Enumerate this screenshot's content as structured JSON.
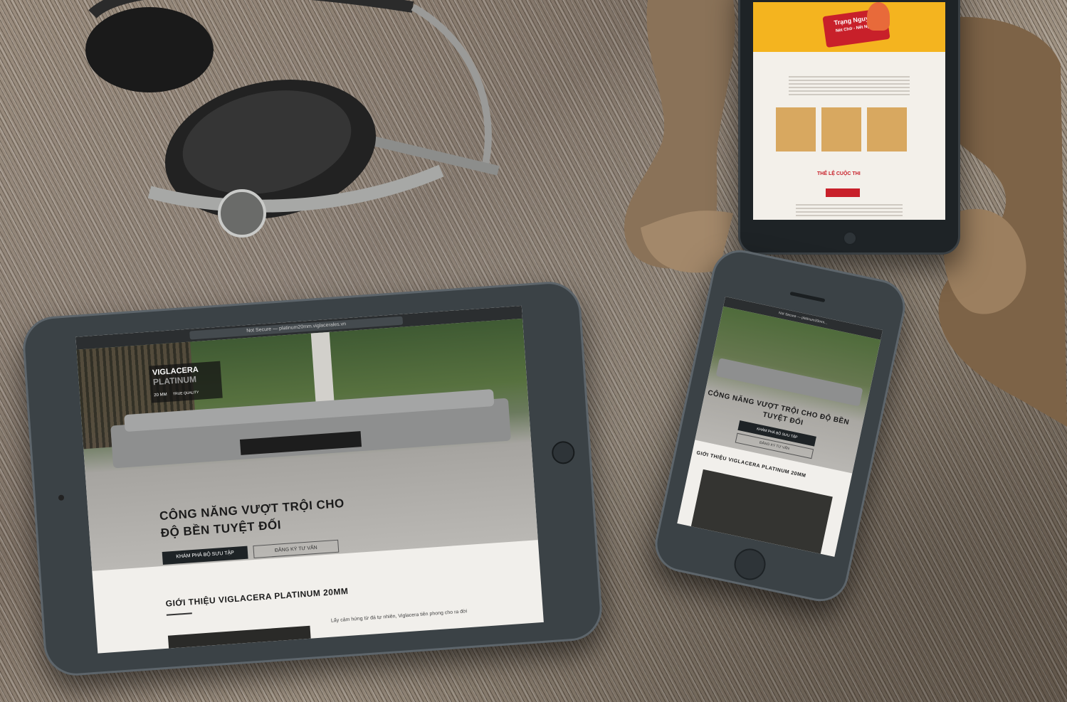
{
  "tablet_large": {
    "url": "Not Secure — platinum20mm.viglacerales.vn",
    "brand": "VIGLACERA",
    "brand_sub": "PLATINUM",
    "brand_tag_mm": "20 MM",
    "brand_tag_q": "TRUE QUALITY",
    "hero_line1": "CÔNG NĂNG VƯỢT TRỘI CHO",
    "hero_line2": "ĐỘ BỀN TUYỆT ĐỐI",
    "btn_primary": "KHÁM PHÁ BỘ SƯU TẬP",
    "btn_secondary": "ĐĂNG KÝ TƯ VẤN",
    "intro_title": "GIỚI THIỆU VIGLACERA PLATINUM 20MM",
    "intro_text": "Lấy cảm hứng từ đá tự nhiên, Viglacera tiên phong cho ra đời"
  },
  "phone": {
    "url": "Not Secure — platinum20mm...",
    "hero_line1": "CÔNG NĂNG VƯỢT TRỘI CHO ĐỘ BỀN",
    "hero_line2": "TUYỆT ĐỐI",
    "btn_primary": "KHÁM PHÁ BỘ SƯU TẬP",
    "btn_secondary": "ĐĂNG KÝ TƯ VẤN",
    "intro_title": "GIỚI THIỆU VIGLACERA PLATINUM 20MM"
  },
  "tablet_small": {
    "headline": "Trạng Nguyên",
    "badge": "Nét Chữ - Nết Người",
    "rules_title": "THỂ LỆ CUỘC THI"
  },
  "colors": {
    "dark_button": "#1e2326",
    "hero_overlay": "#b9b7b3",
    "banner_yellow": "#f4b41f",
    "banner_red": "#c8202a",
    "card_gold": "#d8a860"
  }
}
